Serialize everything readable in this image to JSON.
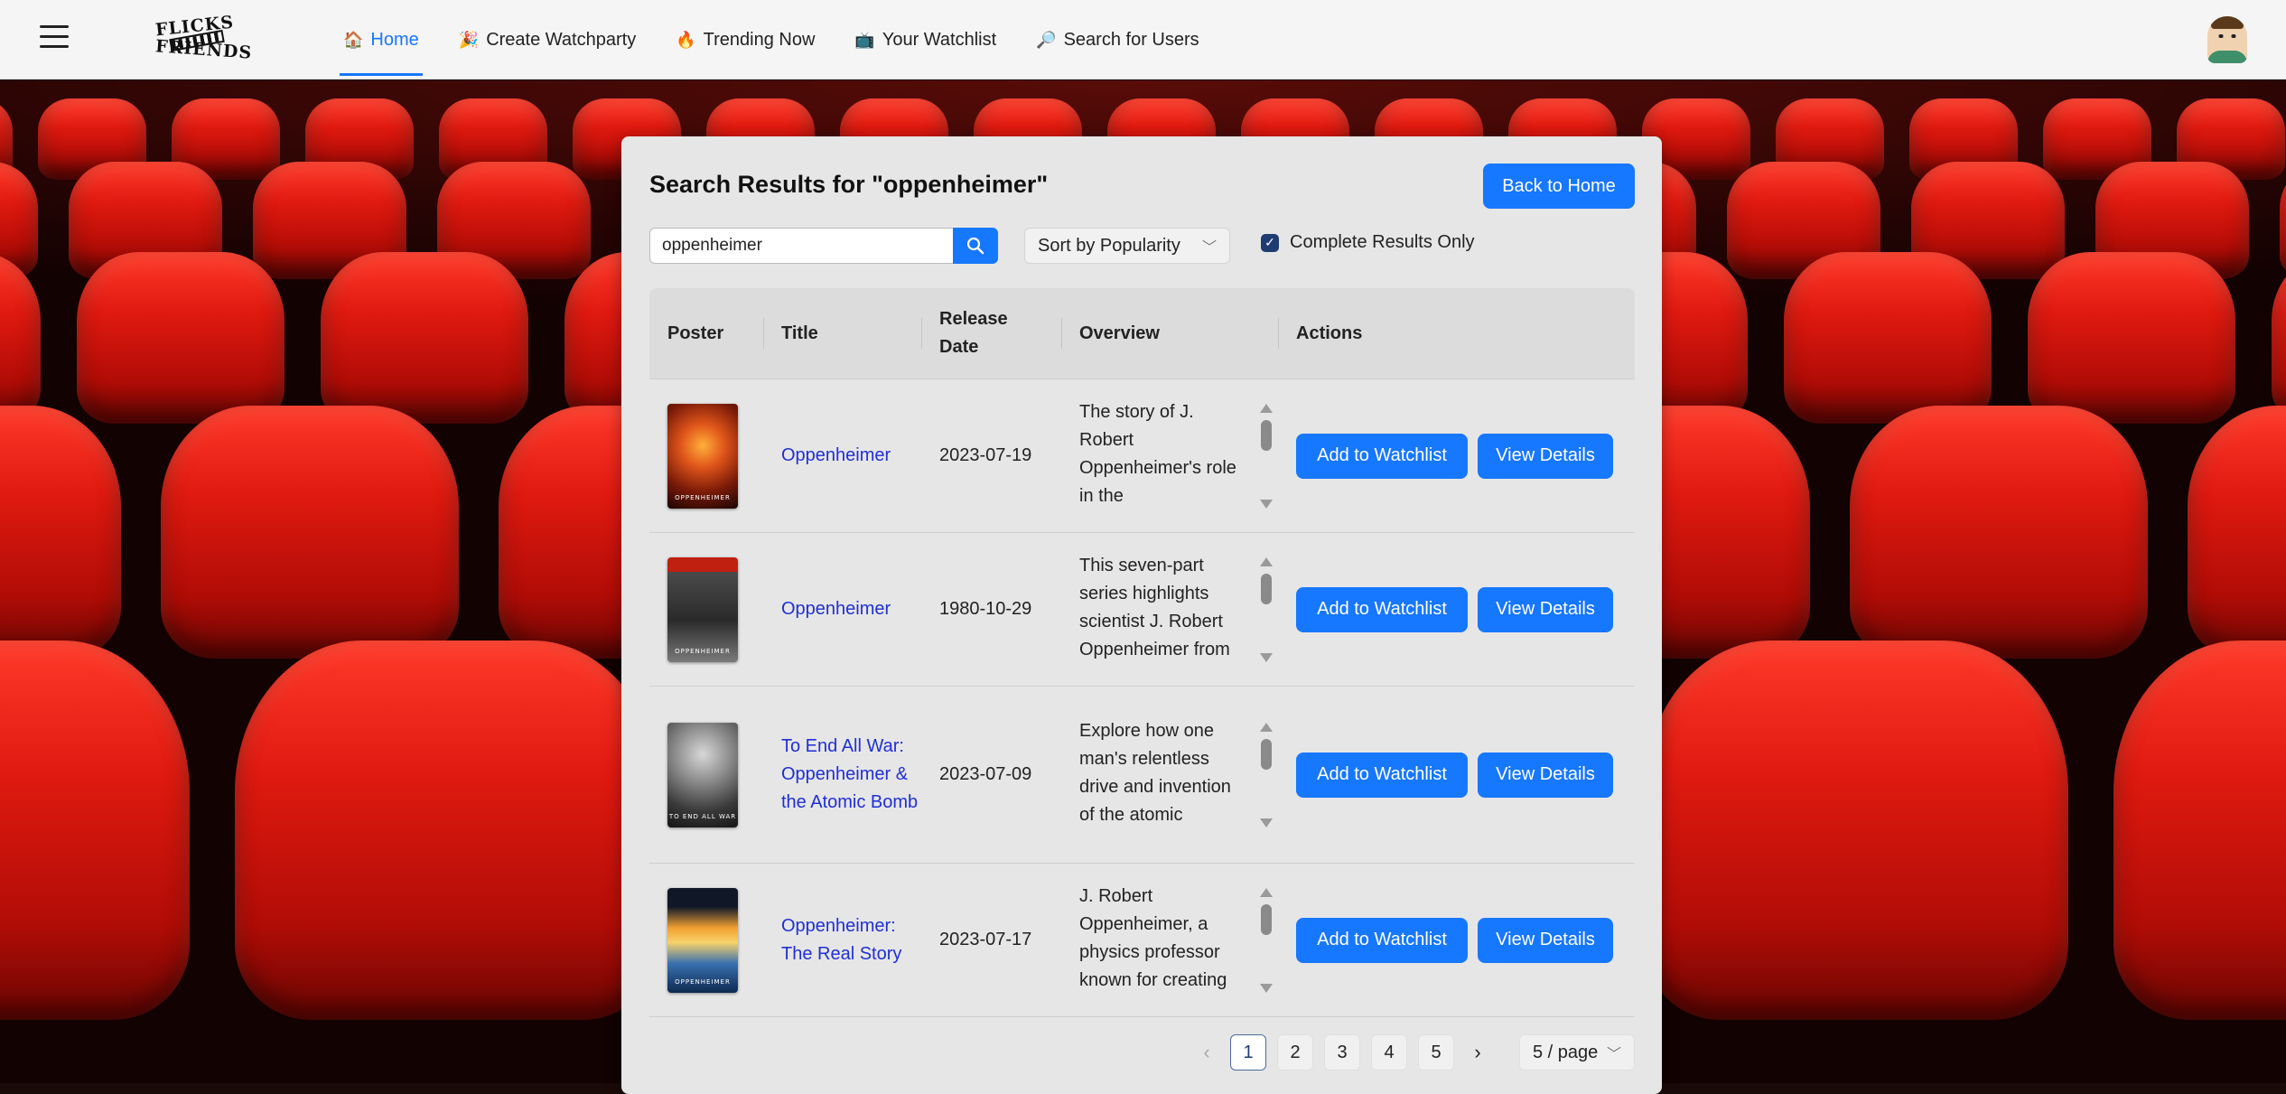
{
  "nav": {
    "logo_line1": "FLICKS",
    "logo_line2": "FRIENDS",
    "items": [
      {
        "icon": "🏠",
        "icon_name": "home-icon",
        "label": "Home",
        "active": true
      },
      {
        "icon": "🎉",
        "icon_name": "party-popper-icon",
        "label": "Create Watchparty"
      },
      {
        "icon": "🔥",
        "icon_name": "fire-icon",
        "label": "Trending Now"
      },
      {
        "icon": "📺",
        "icon_name": "tv-icon",
        "label": "Your Watchlist"
      },
      {
        "icon": "🔎",
        "icon_name": "magnifier-icon",
        "label": "Search for Users"
      }
    ]
  },
  "panel": {
    "title": "Search Results for \"oppenheimer\"",
    "back_label": "Back to Home",
    "search_value": "oppenheimer",
    "sort_label": "Sort by Popularity",
    "complete_only_label": "Complete Results Only",
    "complete_only_checked": true
  },
  "table": {
    "headers": [
      "Poster",
      "Title",
      "Release Date",
      "Overview",
      "Actions"
    ],
    "rows": [
      {
        "title": "Oppenheimer",
        "release_date": "2023-07-19",
        "overview": "The story of J. Robert Oppenheimer's role in the",
        "poster_text": "OPPENHEIMER",
        "add_label": "Add to Watchlist",
        "view_label": "View Details"
      },
      {
        "title": "Oppenheimer",
        "release_date": "1980-10-29",
        "overview": "This seven-part series highlights scientist J. Robert Oppenheimer from",
        "poster_text": "OPPENHEIMER",
        "add_label": "Add to Watchlist",
        "view_label": "View Details"
      },
      {
        "title": "To End All War: Oppenheimer & the Atomic Bomb",
        "release_date": "2023-07-09",
        "overview": "Explore how one man's relentless drive and invention of the atomic",
        "poster_text": "TO END ALL WAR",
        "add_label": "Add to Watchlist",
        "view_label": "View Details"
      },
      {
        "title": "Oppenheimer: The Real Story",
        "release_date": "2023-07-17",
        "overview": "J. Robert Oppenheimer, a physics professor known for creating",
        "poster_text": "OPPENHEIMER",
        "add_label": "Add to Watchlist",
        "view_label": "View Details"
      }
    ]
  },
  "pagination": {
    "pages": [
      "1",
      "2",
      "3",
      "4",
      "5"
    ],
    "current": "1",
    "page_size": "5 / page"
  },
  "colors": {
    "accent": "#1677ff",
    "link": "#1f2fd6",
    "nav_bg": "#f5f5f5",
    "panel_bg": "#e6e6e6"
  }
}
